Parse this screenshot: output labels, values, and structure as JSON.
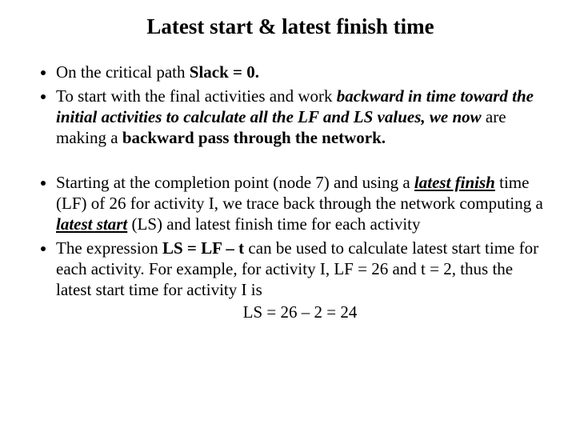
{
  "title": "Latest start & latest finish time",
  "bullets": {
    "a1_pre": "On the critical path ",
    "a1_bold": "Slack = 0.",
    "a2_pre": "To start with the final activities and work ",
    "a2_bi1": "backward in time toward the initial activities to calculate all the LF and LS values, we now ",
    "a2_mid": "are making a ",
    "a2_b2": "backward pass through the network.",
    "b1_pre": "Starting at the completion point (node 7) and using a ",
    "b1_u1": "latest finish",
    "b1_mid1": " time (LF) of 26 for activity I, we trace back through the network computing a ",
    "b1_u2": "latest start",
    "b1_post": " (LS) and latest finish time for each activity",
    "b2_pre": "The expression ",
    "b2_b1": "LS = LF – t",
    "b2_post": " can be used to calculate latest start time for each activity. For example, for activity I, LF = 26 and t = 2, thus the latest start time for activity I is",
    "formula": "LS = 26 – 2 = 24"
  }
}
